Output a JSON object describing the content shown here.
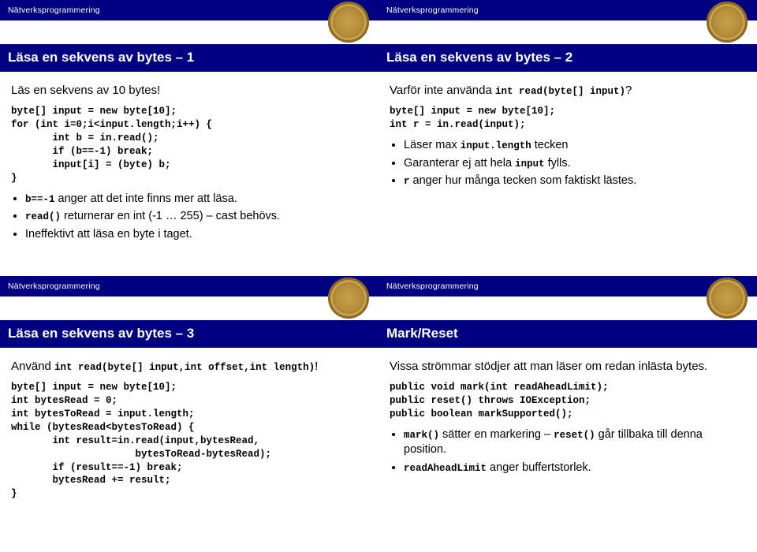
{
  "common": {
    "header_text": "Nätverksprogrammering"
  },
  "slides": {
    "s1": {
      "title": "Läsa en sekvens av bytes – 1",
      "intro": "Läs en sekvens av 10 bytes!",
      "code": "byte[] input = new byte[10];\nfor (int i=0;i<input.length;i++) {\n       int b = in.read();\n       if (b==-1) break;\n       input[i] = (byte) b;\n}",
      "bullets": {
        "b1_code": "b==-1",
        "b1_text": " anger att det inte finns mer att läsa.",
        "b2_code": "read()",
        "b2_text": " returnerar en int (-1 … 255) – cast behövs.",
        "b3_text": "Ineffektivt att läsa en byte i taget."
      }
    },
    "s2": {
      "title": "Läsa en sekvens av bytes – 2",
      "intro_pre": "Varför inte använda ",
      "intro_code": "int read(byte[] input)",
      "intro_post": "?",
      "code": "byte[] input = new byte[10];\nint r = in.read(input);",
      "bullets": {
        "b1_pre": "Läser max ",
        "b1_code": "input.length",
        "b1_post": " tecken",
        "b2_pre": "Garanterar ej att hela ",
        "b2_code": "input",
        "b2_post": " fylls.",
        "b3_code": "r",
        "b3_post": " anger hur många tecken som faktiskt lästes."
      }
    },
    "s3": {
      "title": "Läsa en sekvens av bytes – 3",
      "intro_pre": "Använd ",
      "intro_code": "int read(byte[] input,int offset,int length)",
      "intro_post": "!",
      "code": "byte[] input = new byte[10];\nint bytesRead = 0;\nint bytesToRead = input.length;\nwhile (bytesRead<bytesToRead) {\n       int result=in.read(input,bytesRead,\n                     bytesToRead-bytesRead);\n       if (result==-1) break;\n       bytesRead += result;\n}"
    },
    "s4": {
      "title": "Mark/Reset",
      "intro": "Vissa strömmar stödjer att man läser om redan inlästa bytes.",
      "code": "public void mark(int readAheadLimit);\npublic reset() throws IOException;\npublic boolean markSupported();",
      "bullets": {
        "b1_code1": "mark()",
        "b1_mid": " sätter en markering – ",
        "b1_code2": "reset()",
        "b1_post": " går tillbaka till denna position.",
        "b2_code": "readAheadLimit",
        "b2_post": " anger buffertstorlek."
      }
    }
  }
}
